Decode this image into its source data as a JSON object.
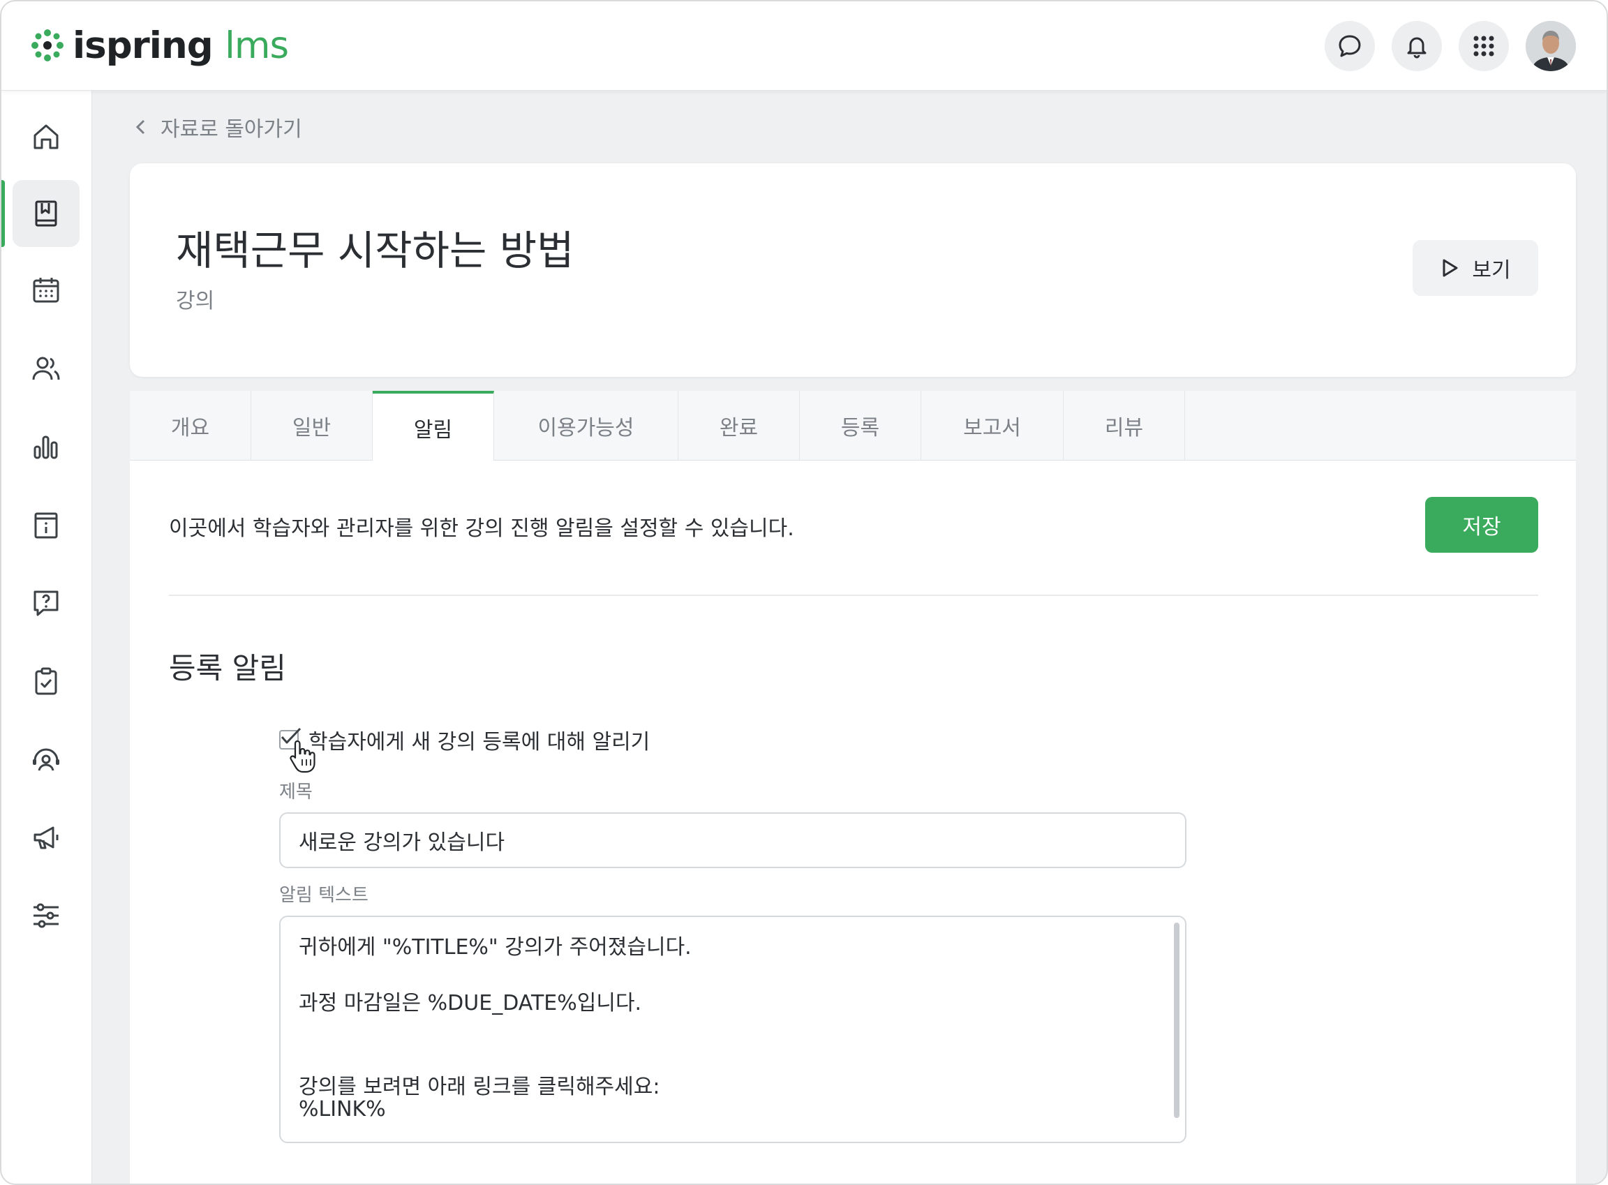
{
  "app": {
    "logo_text_1": "ispring",
    "logo_text_2": "lms",
    "brand_color": "#3aaa5c"
  },
  "topbar": {
    "icons": [
      "chat-icon",
      "bell-icon",
      "apps-grid-icon"
    ],
    "avatar": "user-avatar"
  },
  "sidebar": {
    "items": [
      {
        "icon": "home-icon"
      },
      {
        "icon": "learning-book-icon",
        "active": true
      },
      {
        "icon": "calendar-icon"
      },
      {
        "icon": "users-icon"
      },
      {
        "icon": "reports-chart-icon"
      },
      {
        "icon": "info-board-icon"
      },
      {
        "icon": "question-icon"
      },
      {
        "icon": "clipboard-check-icon"
      },
      {
        "icon": "support-agent-icon"
      },
      {
        "icon": "megaphone-icon"
      },
      {
        "icon": "settings-sliders-icon"
      }
    ]
  },
  "breadcrumb": {
    "back_label": "자료로 돌아가기"
  },
  "course": {
    "title": "재택근무 시작하는 방법",
    "type": "강의",
    "view_label": "보기"
  },
  "tabs": [
    {
      "label": "개요"
    },
    {
      "label": "일반"
    },
    {
      "label": "알림",
      "active": true
    },
    {
      "label": "이용가능성"
    },
    {
      "label": "완료"
    },
    {
      "label": "등록"
    },
    {
      "label": "보고서"
    },
    {
      "label": "리뷰"
    }
  ],
  "notifications": {
    "intro": "이곳에서 학습자와 관리자를 위한 강의 진행 알림을 설정할 수 있습니다.",
    "save_label": "저장",
    "section_title": "등록 알림",
    "notify_checkbox_label": "학습자에게 새 강의 등록에 대해 알리기",
    "notify_checked": true,
    "subject_label": "제목",
    "subject_value": "새로운 강의가 있습니다",
    "body_label": "알림 텍스트",
    "body_lines": [
      "귀하에게 \"%TITLE%\" 강의가 주어졌습니다.",
      "과정 마감일은 %DUE_DATE%입니다.",
      "강의를 보려면 아래 링크를 클릭해주세요:",
      "%LINK%"
    ]
  }
}
